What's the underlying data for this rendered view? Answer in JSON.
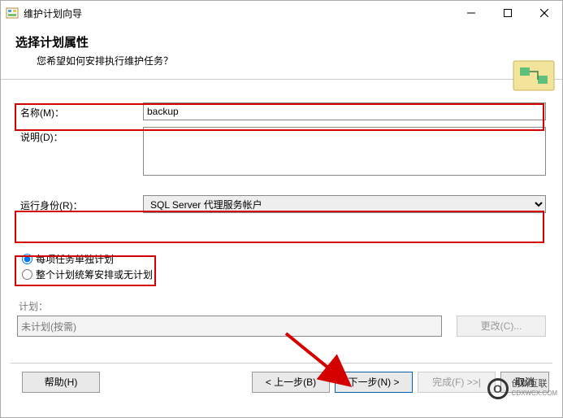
{
  "titlebar": {
    "icon": "wizard-icon",
    "title": "维护计划向导"
  },
  "header": {
    "title": "选择计划属性",
    "subtitle": "您希望如何安排执行维护任务？"
  },
  "form": {
    "name_label": "名称(M)：",
    "name_value": "backup",
    "desc_label": "说明(D)：",
    "desc_value": "",
    "runas_label": "运行身份(R)：",
    "runas_value": "SQL Server 代理服务帐户",
    "radio_separate": "每项任务单独计划",
    "radio_single": "整个计划统筹安排或无计划",
    "schedule_label": "计划：",
    "schedule_value": "未计划(按需)",
    "change_button": "更改(C)..."
  },
  "footer": {
    "help": "帮助(H)",
    "back": "< 上一步(B)",
    "next": "下一步(N) >",
    "finish": "完成(F) >>|",
    "cancel": "取消"
  },
  "watermark": {
    "brand_cn": "创新互联",
    "brand_en": "CDXWCX.COM"
  }
}
